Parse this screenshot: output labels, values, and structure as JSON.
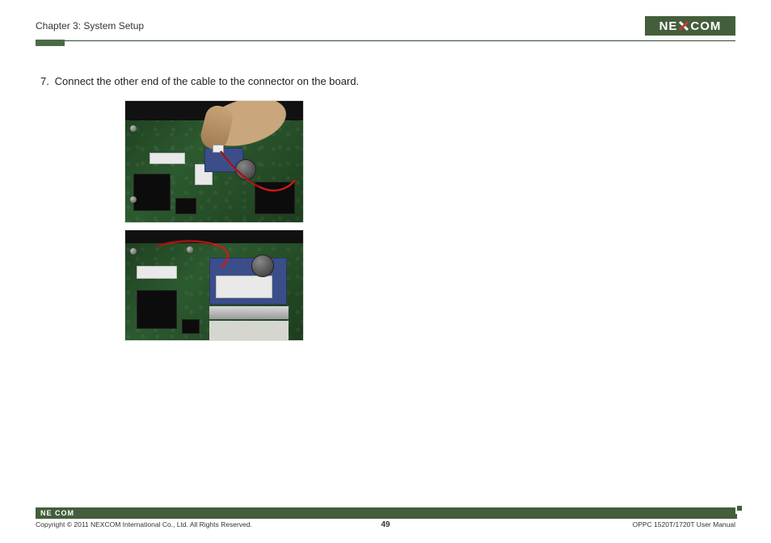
{
  "header": {
    "chapter": "Chapter 3: System Setup",
    "brand_left": "NE",
    "brand_right": "COM"
  },
  "step": {
    "number": "7.",
    "text": "Connect the other end of the cable to the connector on the board."
  },
  "footer": {
    "brand": "NE COM",
    "copyright": "Copyright © 2011 NEXCOM International Co., Ltd. All Rights Reserved.",
    "page_number": "49",
    "manual": "OPPC 1520T/1720T User Manual"
  }
}
